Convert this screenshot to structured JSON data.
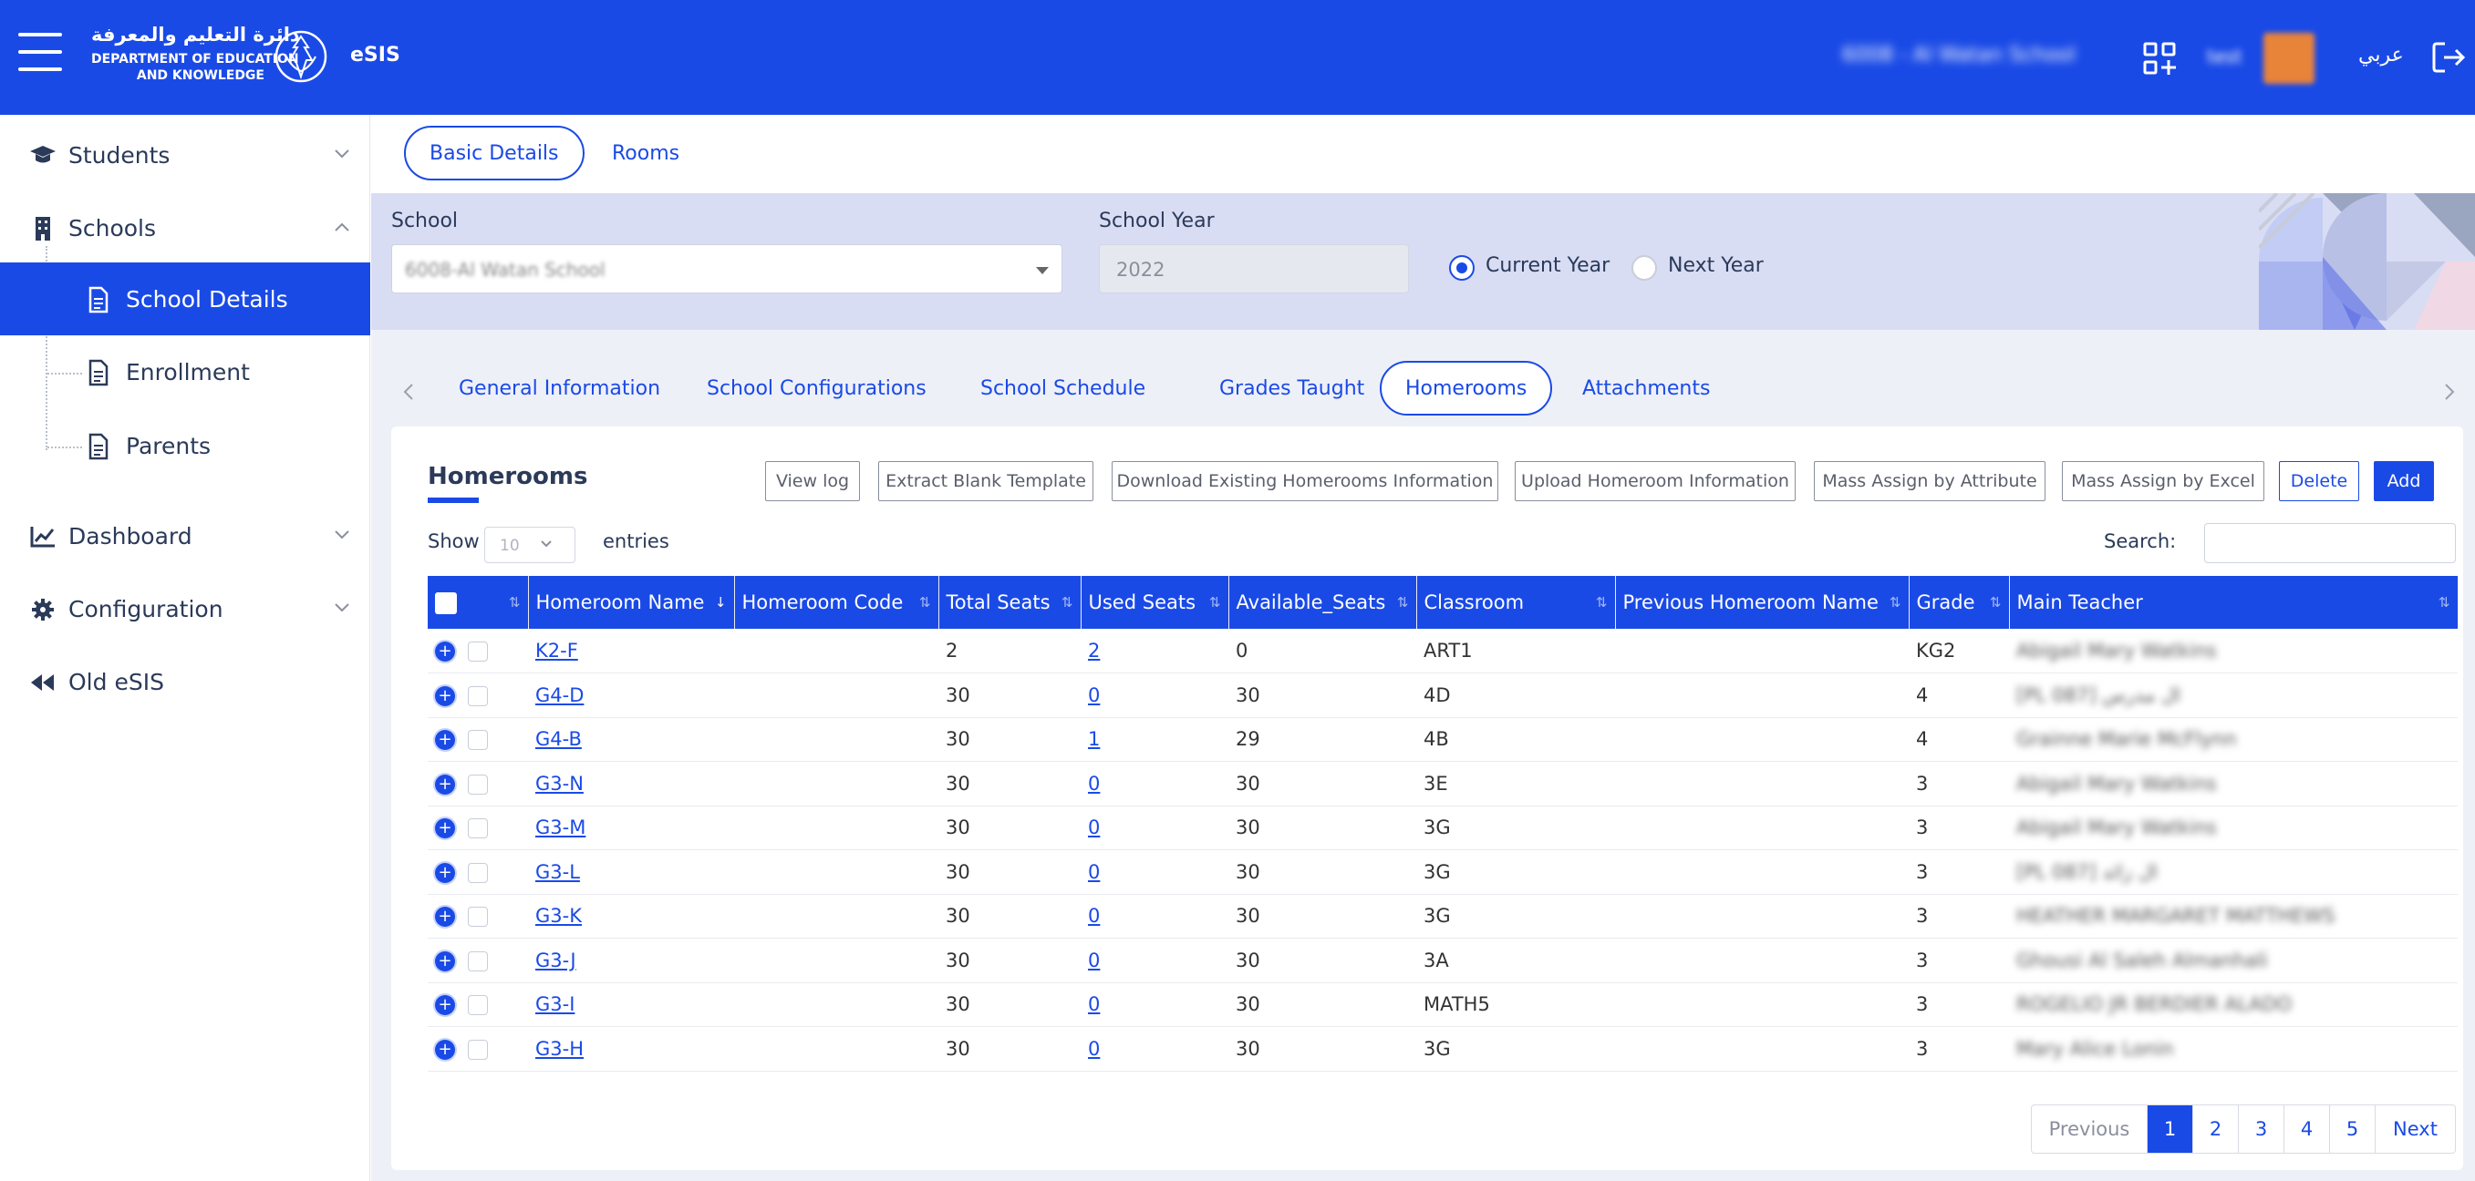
{
  "header": {
    "logo_arabic": "دائرة التعليم والمعرفة",
    "logo_english_line1": "DEPARTMENT OF EDUCATION",
    "logo_english_line2": "AND KNOWLEDGE",
    "app_name": "eSIS",
    "school_name": "6008 - Al Watan School",
    "user_name": "test",
    "language_link": "عربي",
    "icons": [
      "hamburger-icon",
      "dept-emblem-icon",
      "apps-grid-icon",
      "avatar",
      "logout-icon"
    ]
  },
  "sidebar": {
    "items": [
      {
        "label": "Students",
        "icon": "graduation-cap-icon",
        "expanded": false
      },
      {
        "label": "Schools",
        "icon": "building-icon",
        "expanded": true,
        "children": [
          {
            "label": "School Details",
            "icon": "document-icon",
            "active": true
          },
          {
            "label": "Enrollment",
            "icon": "document-icon",
            "active": false
          },
          {
            "label": "Parents",
            "icon": "document-icon",
            "active": false
          }
        ]
      },
      {
        "label": "Dashboard",
        "icon": "chart-line-icon",
        "expanded": false
      },
      {
        "label": "Configuration",
        "icon": "gear-icon",
        "expanded": false
      },
      {
        "label": "Old eSIS",
        "icon": "rewind-icon",
        "expanded": false
      }
    ]
  },
  "top_tabs": {
    "basic_details": "Basic Details",
    "rooms": "Rooms",
    "active": "Basic Details"
  },
  "filters": {
    "school_label": "School",
    "school_value": "6008-Al Watan School",
    "year_label": "School Year",
    "year_value": "2022",
    "current_year": "Current Year",
    "next_year": "Next Year",
    "selected_year_option": "Current Year"
  },
  "section_tabs": {
    "general": "General Information",
    "configurations": "School Configurations",
    "schedule": "School Schedule",
    "grades": "Grades Taught",
    "homerooms": "Homerooms",
    "attachments": "Attachments",
    "active": "Homerooms"
  },
  "homerooms": {
    "title": "Homerooms",
    "buttons": {
      "view_log": "View log",
      "extract_template": "Extract Blank Template",
      "download_existing": "Download Existing Homerooms Information",
      "upload": "Upload Homeroom Information",
      "mass_attribute": "Mass Assign by Attribute",
      "mass_excel": "Mass Assign by Excel",
      "delete": "Delete",
      "add": "Add"
    },
    "show_label": "Show",
    "entries_label": "entries",
    "page_length": "10",
    "search_label": "Search:",
    "search_value": "",
    "columns": [
      "Homeroom Name",
      "Homeroom Code",
      "Total Seats",
      "Used Seats",
      "Available_Seats",
      "Classroom",
      "Previous Homeroom Name",
      "Grade",
      "Main Teacher"
    ],
    "rows": [
      {
        "name": "K2-F",
        "code": "",
        "total": "2",
        "used": "2",
        "available": "0",
        "classroom": "ART1",
        "previous": "",
        "grade": "KG2",
        "teacher": "Abigail Mary Watkins"
      },
      {
        "name": "G4-D",
        "code": "",
        "total": "30",
        "used": "0",
        "available": "30",
        "classroom": "4D",
        "previous": "",
        "grade": "4",
        "teacher": "[PL 087] ال مدرس"
      },
      {
        "name": "G4-B",
        "code": "",
        "total": "30",
        "used": "1",
        "available": "29",
        "classroom": "4B",
        "previous": "",
        "grade": "4",
        "teacher": "Grainne Marie McFlynn"
      },
      {
        "name": "G3-N",
        "code": "",
        "total": "30",
        "used": "0",
        "available": "30",
        "classroom": "3E",
        "previous": "",
        "grade": "3",
        "teacher": "Abigail Mary Watkins"
      },
      {
        "name": "G3-M",
        "code": "",
        "total": "30",
        "used": "0",
        "available": "30",
        "classroom": "3G",
        "previous": "",
        "grade": "3",
        "teacher": "Abigail Mary Watkins"
      },
      {
        "name": "G3-L",
        "code": "",
        "total": "30",
        "used": "0",
        "available": "30",
        "classroom": "3G",
        "previous": "",
        "grade": "3",
        "teacher": "[PL 087] ال زائد"
      },
      {
        "name": "G3-K",
        "code": "",
        "total": "30",
        "used": "0",
        "available": "30",
        "classroom": "3G",
        "previous": "",
        "grade": "3",
        "teacher": "HEATHER MARGARET MATTHEWS"
      },
      {
        "name": "G3-J",
        "code": "",
        "total": "30",
        "used": "0",
        "available": "30",
        "classroom": "3A",
        "previous": "",
        "grade": "3",
        "teacher": "Ghousi Al Saleh Almanhali"
      },
      {
        "name": "G3-I",
        "code": "",
        "total": "30",
        "used": "0",
        "available": "30",
        "classroom": "MATH5",
        "previous": "",
        "grade": "3",
        "teacher": "ROGELIO JR BERDIER ALADO"
      },
      {
        "name": "G3-H",
        "code": "",
        "total": "30",
        "used": "0",
        "available": "30",
        "classroom": "3G",
        "previous": "",
        "grade": "3",
        "teacher": "Mary Alice Lonin"
      }
    ],
    "pagination": {
      "previous": "Previous",
      "pages": [
        "1",
        "2",
        "3",
        "4",
        "5"
      ],
      "current": "1",
      "next": "Next"
    }
  },
  "colors": {
    "brand_blue": "#1a4ae6",
    "band_bg": "#d8ddf4",
    "main_bg": "#eef0f8"
  }
}
